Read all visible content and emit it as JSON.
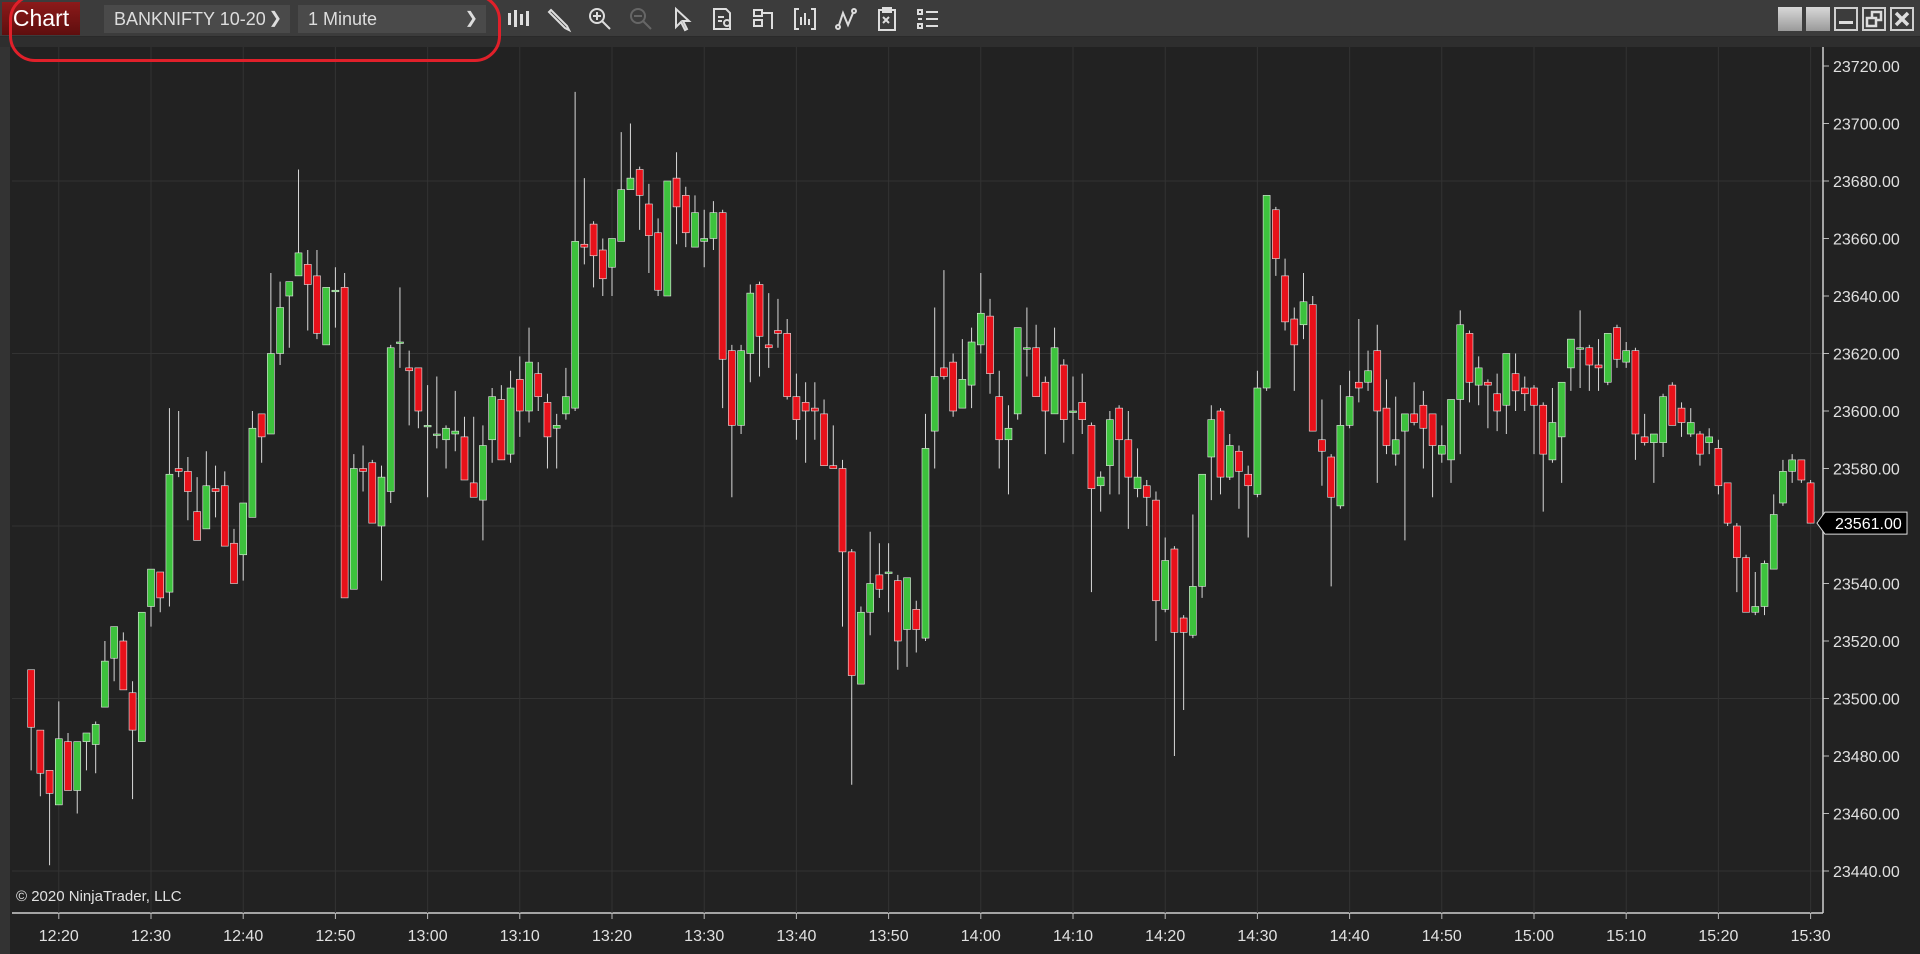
{
  "toolbar": {
    "tab_label": "Chart",
    "instrument": "BANKNIFTY 10-20",
    "interval": "1 Minute",
    "icons": [
      "chart-style-icon",
      "drawing-tool-icon",
      "zoom-in-icon",
      "zoom-out-icon",
      "pointer-icon",
      "data-box-icon",
      "chart-trader-icon",
      "indicators-icon",
      "strategies-icon",
      "properties-icon",
      "templates-icon"
    ],
    "window_buttons": [
      "tile-icon",
      "tile-icon",
      "minimize-icon",
      "restore-icon",
      "close-icon"
    ]
  },
  "copyright": "© 2020 NinjaTrader, LLC",
  "colors": {
    "up": "#3dc23d",
    "down": "#e8111a",
    "wick": "#d8d8d8",
    "background": "#222222",
    "grid": "#333333",
    "annotation": "#e0202a"
  },
  "chart_data": {
    "type": "candlestick",
    "interval": "1 Minute",
    "ylim": [
      23430,
      23730
    ],
    "y_ticks": [
      "23440.00",
      "23460.00",
      "23480.00",
      "23500.00",
      "23520.00",
      "23540.00",
      "23560.00",
      "23580.00",
      "23600.00",
      "23620.00",
      "23640.00",
      "23660.00",
      "23680.00",
      "23700.00",
      "23720.00"
    ],
    "x_ticks": [
      "12:20",
      "12:30",
      "12:40",
      "12:50",
      "13:00",
      "13:10",
      "13:20",
      "13:30",
      "13:40",
      "13:50",
      "14:00",
      "14:10",
      "14:20",
      "14:30",
      "14:40",
      "14:50",
      "15:00",
      "15:10",
      "15:20",
      "15:30"
    ],
    "grid": true,
    "last_price": "23561.00",
    "bar_fields": [
      "time",
      "open",
      "high",
      "low",
      "close"
    ],
    "bars": [
      [
        "12:17",
        23510,
        23510,
        23475,
        23490
      ],
      [
        "12:18",
        23489,
        23489,
        23466,
        23474
      ],
      [
        "12:19",
        23475,
        23475,
        23442,
        23467
      ],
      [
        "12:20",
        23463,
        23499,
        23463,
        23486
      ],
      [
        "12:21",
        23485,
        23488,
        23468,
        23468
      ],
      [
        "12:22",
        23468,
        23485,
        23460,
        23485
      ],
      [
        "12:23",
        23485,
        23488,
        23475,
        23488
      ],
      [
        "12:24",
        23484,
        23492,
        23474,
        23491
      ],
      [
        "12:25",
        23497,
        23520,
        23497,
        23513
      ],
      [
        "12:26",
        23514,
        23525,
        23506,
        23525
      ],
      [
        "12:27",
        23520,
        23523,
        23503,
        23503
      ],
      [
        "12:28",
        23502,
        23506,
        23465,
        23489
      ],
      [
        "12:29",
        23485,
        23530,
        23485,
        23530
      ],
      [
        "12:30",
        23532,
        23545,
        23525,
        23545
      ],
      [
        "12:31",
        23544,
        23544,
        23530,
        23535
      ],
      [
        "12:32",
        23537,
        23601,
        23532,
        23578
      ],
      [
        "12:33",
        23580,
        23600,
        23577,
        23579
      ],
      [
        "12:34",
        23579,
        23584,
        23562,
        23572
      ],
      [
        "12:35",
        23565,
        23577,
        23555,
        23555
      ],
      [
        "12:36",
        23559,
        23586,
        23559,
        23574
      ],
      [
        "12:37",
        23573,
        23581,
        23563,
        23572
      ],
      [
        "12:38",
        23574,
        23579,
        23553,
        23553
      ],
      [
        "12:39",
        23554,
        23559,
        23540,
        23540
      ],
      [
        "12:40",
        23550,
        23568,
        23541,
        23568
      ],
      [
        "12:41",
        23563,
        23600,
        23563,
        23594
      ],
      [
        "12:42",
        23599,
        23599,
        23582,
        23591
      ],
      [
        "12:43",
        23592,
        23648,
        23592,
        23620
      ],
      [
        "12:44",
        23620,
        23645,
        23616,
        23636
      ],
      [
        "12:45",
        23640,
        23645,
        23622,
        23645
      ],
      [
        "12:46",
        23647,
        23684,
        23647,
        23655
      ],
      [
        "12:47",
        23651,
        23656,
        23628,
        23644
      ],
      [
        "12:48",
        23647,
        23656,
        23625,
        23627
      ],
      [
        "12:49",
        23623,
        23643,
        23623,
        23643
      ],
      [
        "12:50",
        23642,
        23650,
        23629,
        23642
      ],
      [
        "12:51",
        23643,
        23648,
        23535,
        23535
      ],
      [
        "12:52",
        23538,
        23585,
        23538,
        23580
      ],
      [
        "12:53",
        23580,
        23588,
        23572,
        23579
      ],
      [
        "12:54",
        23582,
        23583,
        23561,
        23561
      ],
      [
        "12:55",
        23560,
        23581,
        23541,
        23577
      ],
      [
        "12:56",
        23572,
        23623,
        23568,
        23622
      ],
      [
        "12:57",
        23624,
        23643,
        23615,
        23624
      ],
      [
        "12:58",
        23615,
        23621,
        23595,
        23614
      ],
      [
        "12:59",
        23615,
        23615,
        23594,
        23600
      ],
      [
        "13:00",
        23595,
        23609,
        23570,
        23595
      ],
      [
        "13:01",
        23592,
        23612,
        23587,
        23592
      ],
      [
        "13:02",
        23590,
        23595,
        23580,
        23594
      ],
      [
        "13:03",
        23592,
        23607,
        23586,
        23593
      ],
      [
        "13:04",
        23591,
        23598,
        23576,
        23576
      ],
      [
        "13:05",
        23575,
        23598,
        23570,
        23570
      ],
      [
        "13:06",
        23569,
        23595,
        23555,
        23588
      ],
      [
        "13:07",
        23590,
        23608,
        23582,
        23605
      ],
      [
        "13:08",
        23604,
        23609,
        23583,
        23583
      ],
      [
        "13:09",
        23585,
        23614,
        23582,
        23608
      ],
      [
        "13:10",
        23611,
        23619,
        23591,
        23600
      ],
      [
        "13:11",
        23600,
        23629,
        23596,
        23617
      ],
      [
        "13:12",
        23613,
        23617,
        23600,
        23605
      ],
      [
        "13:13",
        23603,
        23606,
        23580,
        23591
      ],
      [
        "13:14",
        23594,
        23599,
        23580,
        23595
      ],
      [
        "13:15",
        23599,
        23615,
        23597,
        23605
      ],
      [
        "13:16",
        23601,
        23711,
        23600,
        23659
      ],
      [
        "13:17",
        23658,
        23681,
        23651,
        23657
      ],
      [
        "13:18",
        23665,
        23666,
        23643,
        23654
      ],
      [
        "13:19",
        23656,
        23660,
        23640,
        23646
      ],
      [
        "13:20",
        23650,
        23660,
        23640,
        23660
      ],
      [
        "13:21",
        23659,
        23697,
        23659,
        23677
      ],
      [
        "13:22",
        23677,
        23700,
        23677,
        23681
      ],
      [
        "13:23",
        23684,
        23685,
        23663,
        23675
      ],
      [
        "13:24",
        23672,
        23679,
        23648,
        23661
      ],
      [
        "13:25",
        23662,
        23667,
        23640,
        23642
      ],
      [
        "13:26",
        23640,
        23680,
        23640,
        23680
      ],
      [
        "13:27",
        23681,
        23690,
        23658,
        23671
      ],
      [
        "13:28",
        23675,
        23678,
        23657,
        23662
      ],
      [
        "13:29",
        23657,
        23675,
        23657,
        23669
      ],
      [
        "13:30",
        23659,
        23670,
        23650,
        23660
      ],
      [
        "13:31",
        23660,
        23673,
        23656,
        23669
      ],
      [
        "13:32",
        23669,
        23670,
        23601,
        23618
      ],
      [
        "13:33",
        23621,
        23623,
        23570,
        23595
      ],
      [
        "13:34",
        23595,
        23623,
        23592,
        23621
      ],
      [
        "13:35",
        23620,
        23644,
        23610,
        23641
      ],
      [
        "13:36",
        23644,
        23645,
        23612,
        23626
      ],
      [
        "13:37",
        23623,
        23641,
        23615,
        23622
      ],
      [
        "13:38",
        23628,
        23639,
        23622,
        23627
      ],
      [
        "13:39",
        23627,
        23632,
        23604,
        23605
      ],
      [
        "13:40",
        23605,
        23613,
        23590,
        23597
      ],
      [
        "13:41",
        23603,
        23610,
        23582,
        23600
      ],
      [
        "13:42",
        23601,
        23610,
        23590,
        23600
      ],
      [
        "13:43",
        23599,
        23604,
        23581,
        23581
      ],
      [
        "13:44",
        23581,
        23595,
        23580,
        23580
      ],
      [
        "13:45",
        23580,
        23583,
        23525,
        23551
      ],
      [
        "13:46",
        23551,
        23552,
        23470,
        23508
      ],
      [
        "13:47",
        23505,
        23532,
        23505,
        23530
      ],
      [
        "13:48",
        23530,
        23558,
        23522,
        23540
      ],
      [
        "13:49",
        23543,
        23554,
        23535,
        23538
      ],
      [
        "13:50",
        23544,
        23554,
        23530,
        23544
      ],
      [
        "13:51",
        23541,
        23543,
        23510,
        23520
      ],
      [
        "13:52",
        23524,
        23542,
        23511,
        23542
      ],
      [
        "13:53",
        23531,
        23534,
        23516,
        23524
      ],
      [
        "13:54",
        23521,
        23599,
        23520,
        23587
      ],
      [
        "13:55",
        23593,
        23636,
        23580,
        23612
      ],
      [
        "13:56",
        23615,
        23649,
        23611,
        23612
      ],
      [
        "13:57",
        23617,
        23620,
        23598,
        23600
      ],
      [
        "13:58",
        23601,
        23625,
        23601,
        23611
      ],
      [
        "13:59",
        23609,
        23629,
        23601,
        23624
      ],
      [
        "14:00",
        23623,
        23648,
        23620,
        23634
      ],
      [
        "14:01",
        23633,
        23639,
        23606,
        23613
      ],
      [
        "14:02",
        23605,
        23614,
        23580,
        23590
      ],
      [
        "14:03",
        23590,
        23602,
        23571,
        23594
      ],
      [
        "14:04",
        23599,
        23629,
        23597,
        23629
      ],
      [
        "14:05",
        23622,
        23636,
        23612,
        23622
      ],
      [
        "14:06",
        23622,
        23630,
        23605,
        23605
      ],
      [
        "14:07",
        23610,
        23612,
        23585,
        23600
      ],
      [
        "14:08",
        23599,
        23629,
        23599,
        23622
      ],
      [
        "14:09",
        23616,
        23618,
        23589,
        23597
      ],
      [
        "14:10",
        23600,
        23612,
        23585,
        23600
      ],
      [
        "14:11",
        23603,
        23613,
        23592,
        23597
      ],
      [
        "14:12",
        23595,
        23596,
        23537,
        23573
      ],
      [
        "14:13",
        23574,
        23579,
        23565,
        23577
      ],
      [
        "14:14",
        23581,
        23600,
        23571,
        23597
      ],
      [
        "14:15",
        23601,
        23602,
        23571,
        23590
      ],
      [
        "14:16",
        23590,
        23600,
        23559,
        23577
      ],
      [
        "14:17",
        23573,
        23587,
        23570,
        23577
      ],
      [
        "14:18",
        23574,
        23576,
        23560,
        23570
      ],
      [
        "14:19",
        23569,
        23572,
        23520,
        23534
      ],
      [
        "14:20",
        23531,
        23556,
        23530,
        23548
      ],
      [
        "14:21",
        23552,
        23553,
        23480,
        23523
      ],
      [
        "14:22",
        23528,
        23529,
        23496,
        23523
      ],
      [
        "14:23",
        23522,
        23564,
        23521,
        23539
      ],
      [
        "14:24",
        23539,
        23578,
        23535,
        23578
      ],
      [
        "14:25",
        23584,
        23602,
        23569,
        23597
      ],
      [
        "14:26",
        23600,
        23601,
        23571,
        23577
      ],
      [
        "14:27",
        23577,
        23592,
        23576,
        23588
      ],
      [
        "14:28",
        23586,
        23588,
        23566,
        23579
      ],
      [
        "14:29",
        23578,
        23581,
        23556,
        23574
      ],
      [
        "14:30",
        23571,
        23614,
        23570,
        23608
      ],
      [
        "14:31",
        23608,
        23675,
        23607,
        23675
      ],
      [
        "14:32",
        23670,
        23671,
        23647,
        23653
      ],
      [
        "14:33",
        23647,
        23653,
        23628,
        23631
      ],
      [
        "14:34",
        23632,
        23636,
        23607,
        23623
      ],
      [
        "14:35",
        23630,
        23648,
        23625,
        23638
      ],
      [
        "14:36",
        23637,
        23640,
        23593,
        23593
      ],
      [
        "14:37",
        23590,
        23604,
        23574,
        23586
      ],
      [
        "14:38",
        23584,
        23585,
        23539,
        23570
      ],
      [
        "14:39",
        23567,
        23609,
        23566,
        23595
      ],
      [
        "14:40",
        23595,
        23614,
        23594,
        23605
      ],
      [
        "14:41",
        23610,
        23632,
        23603,
        23608
      ],
      [
        "14:42",
        23610,
        23621,
        23607,
        23614
      ],
      [
        "14:43",
        23621,
        23630,
        23575,
        23600
      ],
      [
        "14:44",
        23601,
        23611,
        23585,
        23588
      ],
      [
        "14:45",
        23585,
        23605,
        23581,
        23590
      ],
      [
        "14:46",
        23593,
        23599,
        23555,
        23599
      ],
      [
        "14:47",
        23599,
        23610,
        23595,
        23596
      ],
      [
        "14:48",
        23602,
        23607,
        23580,
        23594
      ],
      [
        "14:49",
        23599,
        23599,
        23570,
        23588
      ],
      [
        "14:50",
        23585,
        23595,
        23582,
        23588
      ],
      [
        "14:51",
        23583,
        23604,
        23575,
        23604
      ],
      [
        "14:52",
        23604,
        23635,
        23585,
        23630
      ],
      [
        "14:53",
        23627,
        23628,
        23603,
        23610
      ],
      [
        "14:54",
        23609,
        23619,
        23602,
        23615
      ],
      [
        "14:55",
        23610,
        23611,
        23594,
        23609
      ],
      [
        "14:56",
        23606,
        23613,
        23593,
        23600
      ],
      [
        "14:57",
        23602,
        23620,
        23592,
        23620
      ],
      [
        "14:58",
        23613,
        23620,
        23600,
        23607
      ],
      [
        "14:59",
        23608,
        23612,
        23600,
        23606
      ],
      [
        "15:00",
        23608,
        23609,
        23585,
        23602
      ],
      [
        "15:01",
        23602,
        23603,
        23565,
        23585
      ],
      [
        "15:02",
        23583,
        23608,
        23582,
        23596
      ],
      [
        "15:03",
        23591,
        23610,
        23575,
        23610
      ],
      [
        "15:04",
        23615,
        23625,
        23607,
        23625
      ],
      [
        "15:05",
        23622,
        23635,
        23608,
        23622
      ],
      [
        "15:06",
        23622,
        23623,
        23607,
        23616
      ],
      [
        "15:07",
        23616,
        23625,
        23607,
        23615
      ],
      [
        "15:08",
        23610,
        23627,
        23609,
        23627
      ],
      [
        "15:09",
        23629,
        23630,
        23615,
        23618
      ],
      [
        "15:10",
        23617,
        23624,
        23615,
        23621
      ],
      [
        "15:11",
        23621,
        23622,
        23583,
        23592
      ],
      [
        "15:12",
        23591,
        23599,
        23588,
        23589
      ],
      [
        "15:13",
        23589,
        23592,
        23575,
        23592
      ],
      [
        "15:14",
        23589,
        23606,
        23584,
        23605
      ],
      [
        "15:15",
        23609,
        23610,
        23595,
        23595
      ],
      [
        "15:16",
        23601,
        23603,
        23591,
        23596
      ],
      [
        "15:17",
        23592,
        23601,
        23591,
        23596
      ],
      [
        "15:18",
        23592,
        23593,
        23581,
        23585
      ],
      [
        "15:19",
        23589,
        23594,
        23585,
        23591
      ],
      [
        "15:20",
        23587,
        23590,
        23571,
        23574
      ],
      [
        "15:21",
        23575,
        23575,
        23560,
        23561
      ],
      [
        "15:22",
        23560,
        23561,
        23537,
        23549
      ],
      [
        "15:23",
        23549,
        23550,
        23530,
        23530
      ],
      [
        "15:24",
        23530,
        23544,
        23529,
        23532
      ],
      [
        "15:25",
        23532,
        23548,
        23529,
        23547
      ],
      [
        "15:26",
        23545,
        23571,
        23545,
        23564
      ],
      [
        "15:27",
        23568,
        23583,
        23567,
        23579
      ],
      [
        "15:28",
        23579,
        23585,
        23575,
        23583
      ],
      [
        "15:29",
        23583,
        23583,
        23575,
        23576
      ],
      [
        "15:30",
        23575,
        23576,
        23561,
        23561
      ]
    ]
  }
}
